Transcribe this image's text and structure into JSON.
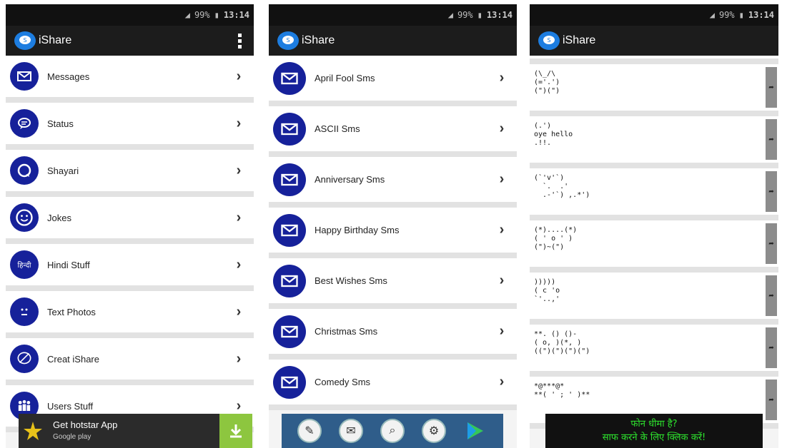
{
  "status_bar": {
    "battery": "99%",
    "time": "13:14"
  },
  "app": {
    "title": "iShare"
  },
  "screen1": {
    "items": [
      {
        "label": "Messages",
        "icon": "envelope-icon"
      },
      {
        "label": "Status",
        "icon": "speech-bubble-icon"
      },
      {
        "label": "Shayari",
        "icon": "chat-icon"
      },
      {
        "label": "Jokes",
        "icon": "smiley-icon"
      },
      {
        "label": "Hindi Stuff",
        "icon": "hindi-text-icon",
        "icon_text": "हिन्दी"
      },
      {
        "label": "Text Photos",
        "icon": "text-face-icon"
      },
      {
        "label": "Creat iShare",
        "icon": "pen-bubble-icon"
      },
      {
        "label": "Users Stuff",
        "icon": "users-icon"
      }
    ],
    "ad": {
      "title": "Get hotstar App",
      "store": "Google play"
    }
  },
  "screen2": {
    "items": [
      {
        "label": "April Fool Sms"
      },
      {
        "label": "ASCII Sms"
      },
      {
        "label": "Anniversary Sms"
      },
      {
        "label": "Happy Birthday Sms"
      },
      {
        "label": "Best Wishes Sms"
      },
      {
        "label": "Christmas Sms"
      },
      {
        "label": "Comedy Sms"
      }
    ],
    "dock": [
      "compose-icon",
      "message-icon",
      "search-icon",
      "gear-icon",
      "play-store-icon"
    ]
  },
  "screen3": {
    "arts": [
      "(\\_/\\\n(='.')\n(\")(\")",
      "(.')\noye hello\n.!!.",
      "(`'v'`)\n  `.  .'\n  .-'`) ,.*')",
      "(*)....(*)\n( ' o ' )\n(\")~(\")",
      ")))))\n( c 'o\n`'..,'",
      "**. () ()-\n( o, )(*, )\n((\")(\")(\")(\")",
      "*@***@*\n**( ' ; ' )**"
    ],
    "ad": {
      "line1": "फोन धीमा है?",
      "line2": "साफ करने के लिए क्लिक करें!"
    }
  },
  "colors": {
    "icon_bg": "#16219a",
    "appbar": "#1c1c1c",
    "logo": "#1d7de0",
    "ad_green": "#2ee52e"
  }
}
